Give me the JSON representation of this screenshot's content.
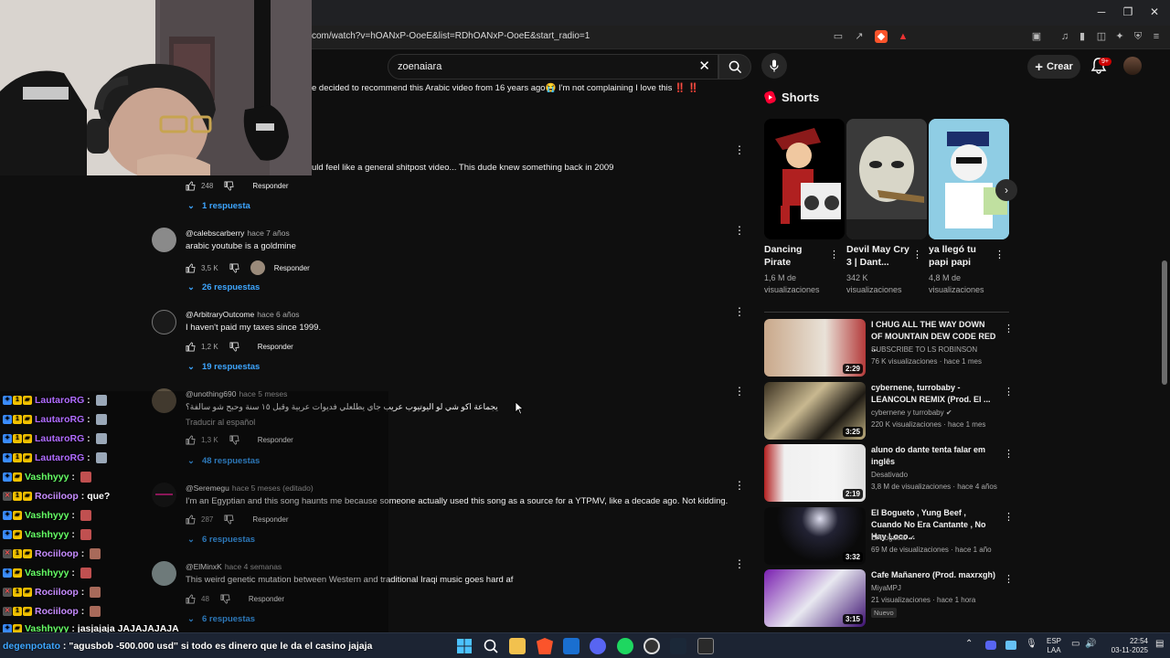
{
  "browser": {
    "url": "com/watch?v=hOANxP-OoeE&list=RDhOANxP-OoeE&start_radio=1",
    "window_minimize": "─",
    "window_maximize": "❐",
    "window_close": "✕"
  },
  "header": {
    "search_value": "zoenaiara",
    "create_label": "Crear",
    "notifications_badge": "9+"
  },
  "comments": [
    {
      "text": "e decided to recommend this Arabic video from 16 years ago😭 I'm not complaining I love this ‼️ ‼️"
    },
    {
      "text": "uld feel like a general shitpost video... This dude knew something back in 2009",
      "likes": "248",
      "reply_label": "Responder",
      "replies": "1 respuesta"
    },
    {
      "author": "@calebscarberry",
      "time": "hace 7 años",
      "text": "arabic youtube is a goldmine",
      "likes": "3,5 K",
      "reply_label": "Responder",
      "replies": "26 respuestas"
    },
    {
      "author": "@ArbitraryOutcome",
      "time": "hace 6 años",
      "text": "I haven't paid my taxes since 1999.",
      "likes": "1,2 K",
      "reply_label": "Responder",
      "replies": "19 respuestas"
    },
    {
      "author": "@unothing690",
      "time": "hace 5 meses",
      "text": "يجماعة اكو شي لو اليوتيوب عريب جاي يطلعلي فديوات عربية وقبل ١٥ سنة وحبح شو سالفة؟",
      "translate": "Traducir al español",
      "likes": "1,3 K",
      "reply_label": "Responder",
      "replies": "48 respuestas"
    },
    {
      "author": "@Seremegu",
      "time": "hace 5 meses (editado)",
      "text": "I'm an Egyptian and this song haunts me because someone actually used this song as a source for a YTPMV, like a decade ago. Not kidding.",
      "likes": "287",
      "reply_label": "Responder",
      "replies": "6 respuestas"
    },
    {
      "author": "@ElMinxK",
      "time": "hace 4 semanas",
      "text": "This weird genetic mutation between Western and traditional Iraqi music goes hard af",
      "likes": "48",
      "reply_label": "Responder",
      "replies": "6 respuestas"
    }
  ],
  "shorts": {
    "title": "Shorts",
    "items": [
      {
        "title": "Dancing Pirate",
        "views": "1,6 M de visualizaciones"
      },
      {
        "title": "Devil May Cry 3 | Dant...",
        "views": "342 K visualizaciones"
      },
      {
        "title": "ya llegó tu papi papi",
        "views": "4,8 M de visualizaciones"
      }
    ]
  },
  "recommendations": [
    {
      "title": "I CHUG ALL THE WAY DOWN OF MOUNTAIN DEW CODE RED ...",
      "channel": "SUBSCRIBE TO LS ROBINSON",
      "meta": "76 K visualizaciones · hace 1 mes",
      "duration": "2:29"
    },
    {
      "title": "cybernene, turrobaby - LEANCOLN REMIX (Prod. El ...",
      "channel": "cybernene y turrobaby",
      "meta": "220 K visualizaciones · hace 1 mes",
      "duration": "3:25"
    },
    {
      "title": "aluno do dante tenta falar em inglês",
      "channel": "Desativado",
      "meta": "3,8 M de visualizaciones · hace 4 años",
      "duration": "2:19"
    },
    {
      "title": "El Bogueto , Yung Beef , Cuando No Era Cantante , No Hay Loco...",
      "channel": "El Bogueto",
      "meta": "69 M de visualizaciones · hace 1 año",
      "duration": "3:32"
    },
    {
      "title": "Cafe Mañanero (Prod. maxrxgh)",
      "channel": "MiyaMPJ",
      "meta": "21 visualizaciones · hace 1 hora",
      "duration": "3:15",
      "badge": "Nuevo"
    }
  ],
  "chat": [
    {
      "user": "LautaroRG",
      "msg": "",
      "color": "#b06cff"
    },
    {
      "user": "LautaroRG",
      "msg": "",
      "color": "#b06cff"
    },
    {
      "user": "LautaroRG",
      "msg": "",
      "color": "#b06cff"
    },
    {
      "user": "LautaroRG",
      "msg": "",
      "color": "#b06cff"
    },
    {
      "user": "Vashhyyy",
      "msg": "",
      "color": "#66ff66"
    },
    {
      "user": "Rociiloop",
      "msg": "que?",
      "color": "#c78cff"
    },
    {
      "user": "Vashhyyy",
      "msg": "",
      "color": "#66ff66"
    },
    {
      "user": "Vashhyyy",
      "msg": "",
      "color": "#66ff66"
    },
    {
      "user": "Rociiloop",
      "msg": "",
      "color": "#c78cff"
    },
    {
      "user": "Vashhyyy",
      "msg": "",
      "color": "#66ff66"
    },
    {
      "user": "Rociiloop",
      "msg": "",
      "color": "#c78cff"
    },
    {
      "user": "Rociiloop",
      "msg": "",
      "color": "#c78cff"
    },
    {
      "user": "Vashhyyy",
      "msg": "jasjajaja JAJAJAJAJA",
      "color": "#66ff66"
    }
  ],
  "taskbar": {
    "chat_ticker_user": "degenpotato",
    "chat_ticker_msg": "\"agusbob -500.000 usd\" si todo es dinero que le da el casino jajaja",
    "lang_top": "ESP",
    "lang_bottom": "LAA",
    "time": "22:54",
    "date": "03-11-2025"
  }
}
